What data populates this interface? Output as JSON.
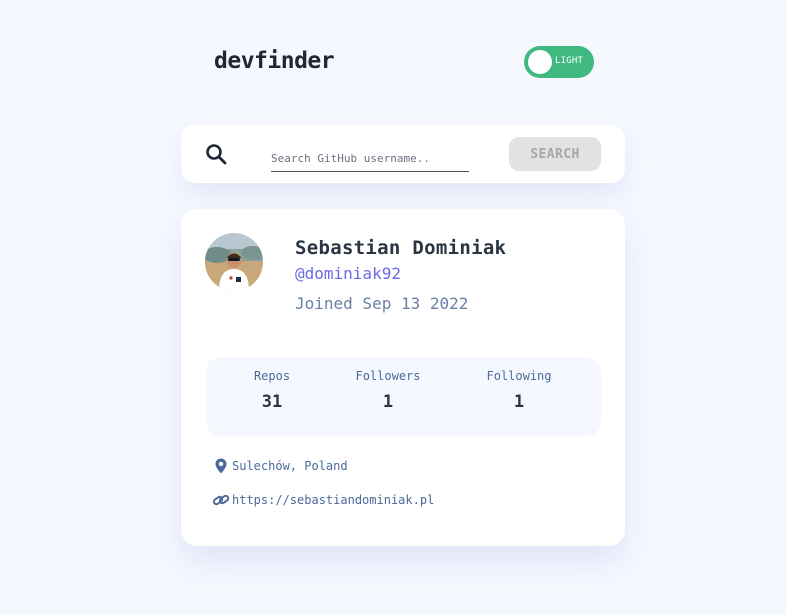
{
  "header": {
    "logo": "devfinder",
    "theme_toggle_label": "LIGHT"
  },
  "search": {
    "placeholder": "Search GitHub username..",
    "value": "",
    "button_label": "SEARCH"
  },
  "profile": {
    "name": "Sebastian Dominiak",
    "login": "@dominiak92",
    "joined": "Joined Sep 13 2022"
  },
  "stats": [
    {
      "label": "Repos",
      "value": "31"
    },
    {
      "label": "Followers",
      "value": "1"
    },
    {
      "label": "Following",
      "value": "1"
    }
  ],
  "links": {
    "location": "Sulechów, Poland",
    "website": "https://sebastiandominiak.pl"
  },
  "colors": {
    "accent": "#6b69e7",
    "toggle_on": "#3fb97f",
    "page_bg": "#f6f8ff",
    "card_bg": "#ffffff",
    "text_dark": "#2b3442",
    "text_muted": "#4b6a9b"
  },
  "icons": [
    "search-icon",
    "location-pin-icon",
    "link-icon",
    "avatar-photo"
  ]
}
